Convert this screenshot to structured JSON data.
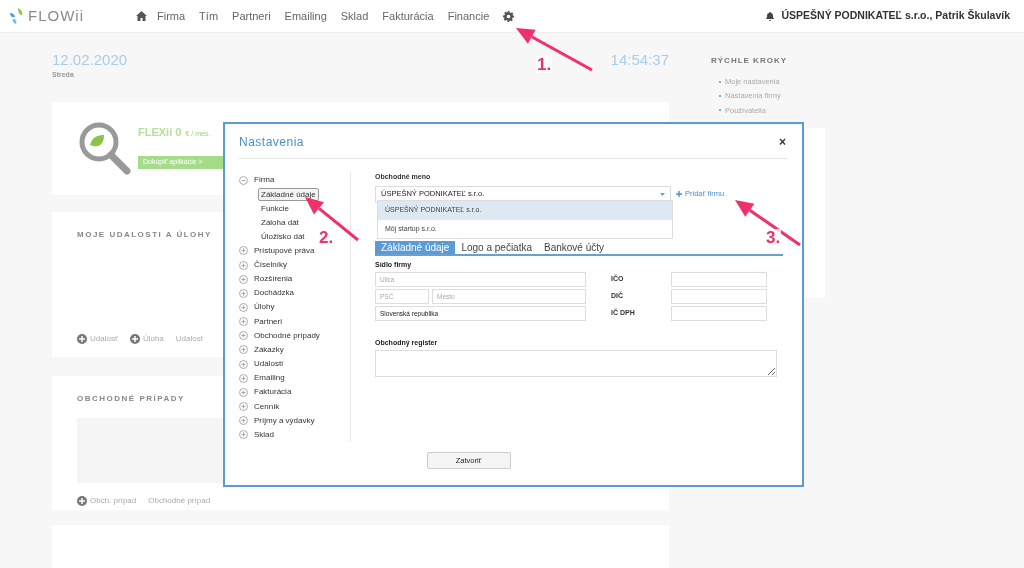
{
  "nav": {
    "logo": "FLOWii",
    "items": [
      "Firma",
      "Tím",
      "Partneri",
      "Emailing",
      "Sklad",
      "Fakturácia",
      "Financie"
    ],
    "account": "ÚSPEŠNÝ PODNIKATEĽ s.r.o., Patrik Škulavík"
  },
  "dashboard": {
    "date": "12.02.2020",
    "weekday": "Streda",
    "time": "14:54:37",
    "promo": {
      "title": "FLEXii 0",
      "price": "€ / mes.",
      "button": "Dokúpiť aplikácie >"
    },
    "events": {
      "title": "MOJE UDALOSTI A ÚLOHY",
      "actions": [
        {
          "label": "Udalosť",
          "kind": "add"
        },
        {
          "label": "Úloha",
          "kind": "add"
        },
        {
          "label": "Udalost",
          "kind": "link"
        }
      ]
    },
    "cases": {
      "title": "OBCHODNÉ PRÍPADY",
      "actions": [
        {
          "label": "Obch. prípad",
          "kind": "add"
        },
        {
          "label": "Obchodné prípad",
          "kind": "link"
        }
      ]
    },
    "quick_steps": {
      "title": "RÝCHLE KROKY",
      "links": [
        "Moje nastavenia",
        "Nastavenia firmy",
        "Používatelia"
      ]
    }
  },
  "dialog": {
    "title": "Nastavenia",
    "close": "×",
    "tree": [
      {
        "label": "Firma",
        "expanded": true,
        "selected": false,
        "children": [
          {
            "label": "Základné údaje",
            "selected": true
          },
          {
            "label": "Funkcie",
            "selected": false
          },
          {
            "label": "Záloha dát",
            "selected": false
          },
          {
            "label": "Úložisko dát",
            "selected": false
          }
        ]
      },
      {
        "label": "Prístupové práva",
        "expanded": false,
        "selected": false
      },
      {
        "label": "Číselníky",
        "expanded": false,
        "selected": false
      },
      {
        "label": "Rozšírenia",
        "expanded": false,
        "selected": false
      },
      {
        "label": "Dochádzka",
        "expanded": false,
        "selected": false
      },
      {
        "label": "Úlohy",
        "expanded": false,
        "selected": false
      },
      {
        "label": "Partneri",
        "expanded": false,
        "selected": false
      },
      {
        "label": "Obchodné prípady",
        "expanded": false,
        "selected": false
      },
      {
        "label": "Zákazky",
        "expanded": false,
        "selected": false
      },
      {
        "label": "Udalosti",
        "expanded": false,
        "selected": false
      },
      {
        "label": "Emailing",
        "expanded": false,
        "selected": false
      },
      {
        "label": "Fakturácia",
        "expanded": false,
        "selected": false
      },
      {
        "label": "Cenník",
        "expanded": false,
        "selected": false
      },
      {
        "label": "Príjmy a výdavky",
        "expanded": false,
        "selected": false
      },
      {
        "label": "Sklad",
        "expanded": false,
        "selected": false
      }
    ],
    "company_label": "Obchodné meno",
    "company_value": "ÚSPEŠNÝ PODNIKATEĽ s.r.o.",
    "add_company": "Pridať firmu",
    "company_options": [
      {
        "label": "ÚSPEŠNÝ PODNIKATEĽ s.r.o.",
        "selected": true
      },
      {
        "label": "Môj startup s.r.o.",
        "selected": false
      }
    ],
    "tabs": [
      {
        "label": "Základné údaje",
        "selected": true
      },
      {
        "label": "Logo a pečiatka",
        "selected": false
      },
      {
        "label": "Bankové účty",
        "selected": false
      }
    ],
    "address_label": "Sídlo firmy",
    "street": {
      "placeholder": "Ulica"
    },
    "zip": {
      "placeholder": "PSČ"
    },
    "city": {
      "placeholder": "Mesto"
    },
    "country": {
      "value": "Slovenská republika"
    },
    "ids": [
      {
        "label": "IČO"
      },
      {
        "label": "DIČ"
      },
      {
        "label": "IČ DPH"
      }
    ],
    "register_label": "Obchodný register",
    "close_button": "Zatvoriť"
  },
  "annotations": [
    {
      "label": "1."
    },
    {
      "label": "2."
    },
    {
      "label": "3."
    }
  ]
}
